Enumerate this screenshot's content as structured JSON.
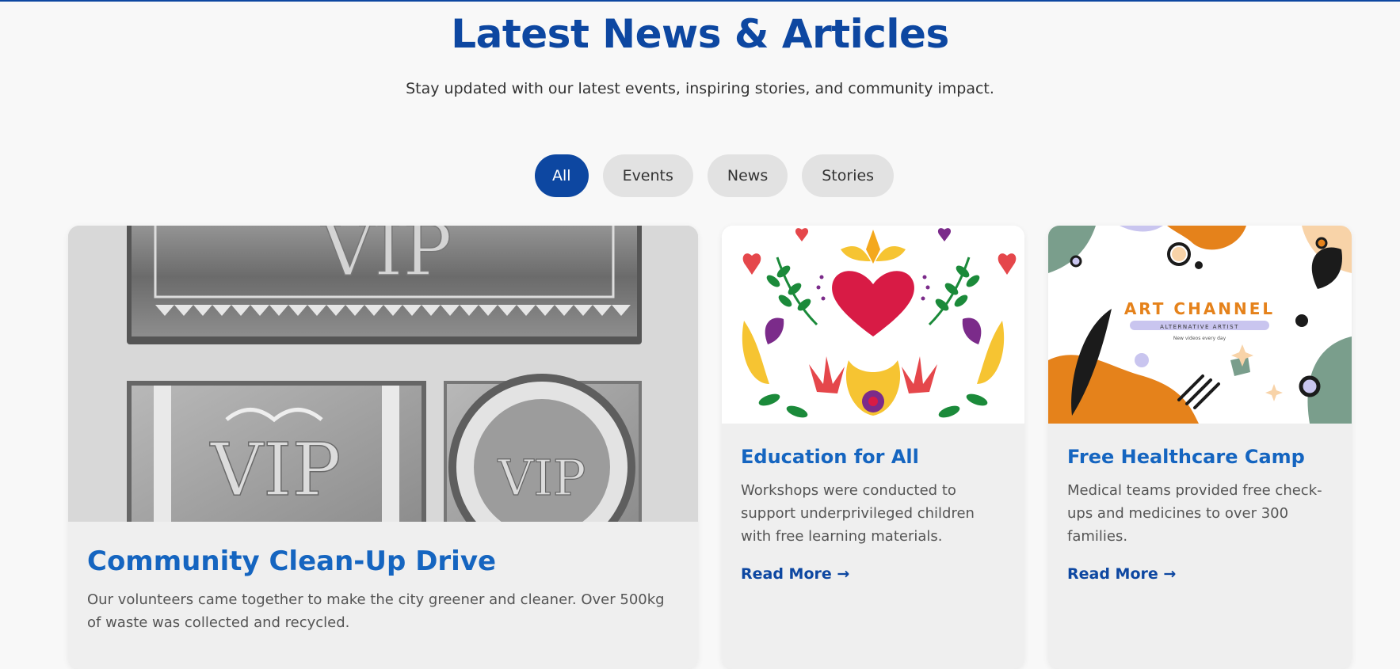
{
  "header": {
    "title": "Latest News & Articles",
    "subtitle": "Stay updated with our latest events, inspiring stories, and community impact."
  },
  "filters": [
    {
      "label": "All",
      "active": true
    },
    {
      "label": "Events",
      "active": false
    },
    {
      "label": "News",
      "active": false
    },
    {
      "label": "Stories",
      "active": false
    }
  ],
  "articles": [
    {
      "title": "Community Clean-Up Drive",
      "text": "Our volunteers came together to make the city greener and cleaner. Over 500kg of waste was collected and recycled.",
      "image_text": "VIP"
    },
    {
      "title": "Education for All",
      "text": "Workshops were conducted to support underprivileged children with free learning materials.",
      "read_more": "Read More →"
    },
    {
      "title": "Free Healthcare Camp",
      "text": "Medical teams provided free check-ups and medicines to over 300 families.",
      "read_more": "Read More →",
      "image_text": {
        "brand": "ART CHANNEL",
        "tagline": "ALTERNATIVE ARTIST",
        "small": "New videos every day"
      }
    }
  ],
  "colors": {
    "primary": "#0d47a1",
    "title_link": "#1565c0",
    "chip_bg": "#e2e2e2"
  }
}
